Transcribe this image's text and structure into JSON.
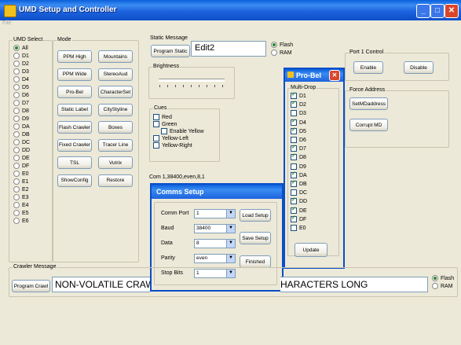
{
  "window": {
    "title": "UMD Setup and Controller",
    "menu": "File"
  },
  "umd_select": {
    "label": "UMD Select",
    "items": [
      "All",
      "D1",
      "D2",
      "D3",
      "D4",
      "D5",
      "D6",
      "D7",
      "D8",
      "D9",
      "DA",
      "DB",
      "DC",
      "DD",
      "DE",
      "DF",
      "E0",
      "E1",
      "E2",
      "E3",
      "E4",
      "E5",
      "E6"
    ],
    "selected": "All"
  },
  "mode": {
    "label": "Mode",
    "buttons": [
      [
        "PPM High",
        "Mountains"
      ],
      [
        "PPM Wide",
        "StereoAud"
      ],
      [
        "Pro-Bel",
        "CharacterSet"
      ],
      [
        "Static Label",
        "CityStyline"
      ],
      [
        "Flash Crawler",
        "Boxes"
      ],
      [
        "Fixed Crawler",
        "Tracer Line"
      ],
      [
        "TSL",
        "Vutrix"
      ],
      [
        "ShowConfig",
        "Restore"
      ]
    ]
  },
  "static_message": {
    "label": "Static Message",
    "button": "Program Static",
    "value": "Edit2",
    "options": [
      "Flash",
      "RAM"
    ],
    "selected": "Flash"
  },
  "brightness": {
    "label": "Brightness",
    "level": 0.0
  },
  "cues": {
    "label": "Cues",
    "items": [
      {
        "label": "Red",
        "checked": false
      },
      {
        "label": "Green",
        "checked": false
      },
      {
        "label": "Enable Yellow",
        "checked": false
      },
      {
        "label": "Yellow-Left",
        "checked": false
      },
      {
        "label": "Yellow-Right",
        "checked": false
      }
    ]
  },
  "com_status": "Com 1,38400,even,8,1",
  "port_control": {
    "label": "Port 1 Control",
    "enable": "Enable",
    "disable": "Disable"
  },
  "force_address": {
    "label": "Force Address",
    "set_button": "SetMDaddress",
    "corrupt_button": "Corrupt MD"
  },
  "probel": {
    "title": "Pro-Bel",
    "group_label": "Multi-Drop",
    "items": [
      {
        "label": "D1",
        "checked": true
      },
      {
        "label": "D2",
        "checked": true
      },
      {
        "label": "D3",
        "checked": false
      },
      {
        "label": "D4",
        "checked": true
      },
      {
        "label": "D5",
        "checked": true
      },
      {
        "label": "D6",
        "checked": false
      },
      {
        "label": "D7",
        "checked": true
      },
      {
        "label": "D8",
        "checked": true
      },
      {
        "label": "D9",
        "checked": false
      },
      {
        "label": "DA",
        "checked": true
      },
      {
        "label": "DB",
        "checked": true
      },
      {
        "label": "DC",
        "checked": false
      },
      {
        "label": "DD",
        "checked": true
      },
      {
        "label": "DE",
        "checked": true
      },
      {
        "label": "DF",
        "checked": true
      },
      {
        "label": "E0",
        "checked": false
      }
    ],
    "update": "Update"
  },
  "comms": {
    "title": "Comms Setup",
    "fields": [
      {
        "label": "Comm Port",
        "value": "1"
      },
      {
        "label": "Baud",
        "value": "38400"
      },
      {
        "label": "Data",
        "value": "8"
      },
      {
        "label": "Parity",
        "value": "even"
      },
      {
        "label": "Stop Bits",
        "value": "1"
      }
    ],
    "load": "Load Setup",
    "save": "Save Setup",
    "finished": "Finished"
  },
  "crawler": {
    "label": "Crawler Message",
    "button": "Program Crawl",
    "text_left": "NON-VOLATILE CRAW",
    "text_right": "HARACTERS LONG",
    "options": [
      "Flash",
      "RAM"
    ],
    "selected": "Flash"
  },
  "colors": {
    "title_blue": "#0A4EC8",
    "window_bg": "#ECE9D8",
    "close_red": "#D9462B"
  }
}
